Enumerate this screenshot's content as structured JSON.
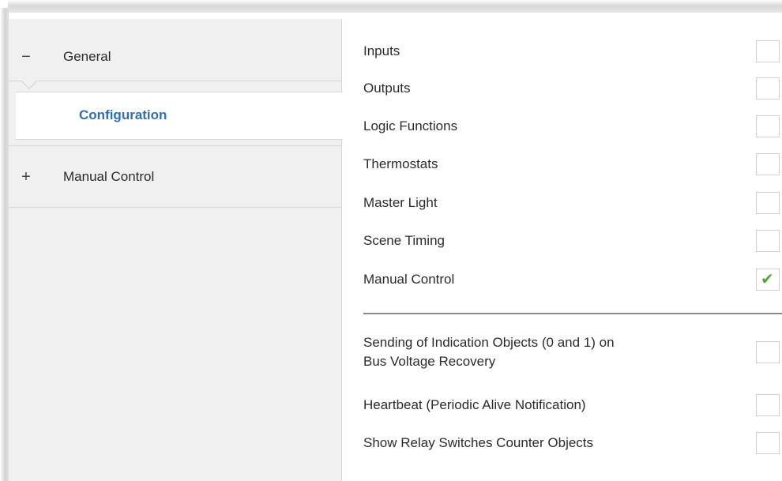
{
  "tree": {
    "general": {
      "sign": "−",
      "label": "General"
    },
    "configuration": {
      "label": "Configuration"
    },
    "manual_control": {
      "sign": "+",
      "label": "Manual Control"
    }
  },
  "settings": {
    "group1": [
      {
        "label": "Inputs",
        "checked": false
      },
      {
        "label": "Outputs",
        "checked": false
      },
      {
        "label": "Logic Functions",
        "checked": false
      },
      {
        "label": "Thermostats",
        "checked": false
      },
      {
        "label": "Master Light",
        "checked": false
      },
      {
        "label": "Scene Timing",
        "checked": false
      },
      {
        "label": "Manual Control",
        "checked": true
      }
    ],
    "group2": [
      {
        "label_line1": "Sending of Indication Objects (0 and 1) on",
        "label_line2": "Bus Voltage Recovery",
        "checked": false
      },
      {
        "label": "Heartbeat (Periodic Alive Notification)",
        "checked": false
      },
      {
        "label": "Show Relay Switches Counter Objects",
        "checked": false
      }
    ],
    "check_glyph": "✔"
  },
  "colors": {
    "accent": "#2e6fb3",
    "check": "#5aa33c",
    "tree_bg": "#f0f0f0"
  }
}
